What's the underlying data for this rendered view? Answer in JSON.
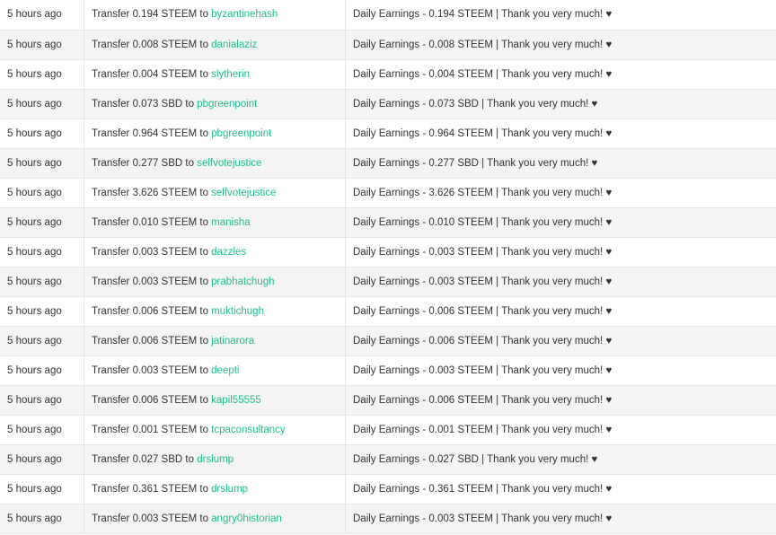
{
  "history": {
    "rows": [
      {
        "time": "5 hours ago",
        "op_prefix": "Transfer 0.194 STEEM to ",
        "account": "byzantinehash",
        "memo": "Daily Earnings - 0.194 STEEM | Thank you very much! ",
        "heart": "♥"
      },
      {
        "time": "5 hours ago",
        "op_prefix": "Transfer 0.008 STEEM to ",
        "account": "danialaziz",
        "memo": "Daily Earnings - 0.008 STEEM | Thank you very much! ",
        "heart": "♥"
      },
      {
        "time": "5 hours ago",
        "op_prefix": "Transfer 0.004 STEEM to ",
        "account": "slytherin",
        "memo": "Daily Earnings - 0.004 STEEM | Thank you very much! ",
        "heart": "♥"
      },
      {
        "time": "5 hours ago",
        "op_prefix": "Transfer 0.073 SBD to ",
        "account": "pbgreenpoint",
        "memo": "Daily Earnings - 0.073 SBD | Thank you very much! ",
        "heart": "♥"
      },
      {
        "time": "5 hours ago",
        "op_prefix": "Transfer 0.964 STEEM to ",
        "account": "pbgreenpoint",
        "memo": "Daily Earnings - 0.964 STEEM | Thank you very much! ",
        "heart": "♥"
      },
      {
        "time": "5 hours ago",
        "op_prefix": "Transfer 0.277 SBD to ",
        "account": "selfvotejustice",
        "memo": "Daily Earnings - 0.277 SBD | Thank you very much! ",
        "heart": "♥"
      },
      {
        "time": "5 hours ago",
        "op_prefix": "Transfer 3.626 STEEM to ",
        "account": "selfvotejustice",
        "memo": "Daily Earnings - 3.626 STEEM | Thank you very much! ",
        "heart": "♥"
      },
      {
        "time": "5 hours ago",
        "op_prefix": "Transfer 0.010 STEEM to ",
        "account": "manisha",
        "memo": "Daily Earnings - 0.010 STEEM | Thank you very much! ",
        "heart": "♥"
      },
      {
        "time": "5 hours ago",
        "op_prefix": "Transfer 0.003 STEEM to ",
        "account": "dazzles",
        "memo": "Daily Earnings - 0.003 STEEM | Thank you very much! ",
        "heart": "♥"
      },
      {
        "time": "5 hours ago",
        "op_prefix": "Transfer 0.003 STEEM to ",
        "account": "prabhatchugh",
        "memo": "Daily Earnings - 0.003 STEEM | Thank you very much! ",
        "heart": "♥"
      },
      {
        "time": "5 hours ago",
        "op_prefix": "Transfer 0.006 STEEM to ",
        "account": "muktichugh",
        "memo": "Daily Earnings - 0.006 STEEM | Thank you very much! ",
        "heart": "♥"
      },
      {
        "time": "5 hours ago",
        "op_prefix": "Transfer 0.006 STEEM to ",
        "account": "jatinarora",
        "memo": "Daily Earnings - 0.006 STEEM | Thank you very much! ",
        "heart": "♥"
      },
      {
        "time": "5 hours ago",
        "op_prefix": "Transfer 0.003 STEEM to ",
        "account": "deepti",
        "memo": "Daily Earnings - 0.003 STEEM | Thank you very much! ",
        "heart": "♥"
      },
      {
        "time": "5 hours ago",
        "op_prefix": "Transfer 0.006 STEEM to ",
        "account": "kapil55555",
        "memo": "Daily Earnings - 0.006 STEEM | Thank you very much! ",
        "heart": "♥"
      },
      {
        "time": "5 hours ago",
        "op_prefix": "Transfer 0.001 STEEM to ",
        "account": "tcpaconsultancy",
        "memo": "Daily Earnings - 0.001 STEEM | Thank you very much! ",
        "heart": "♥"
      },
      {
        "time": "5 hours ago",
        "op_prefix": "Transfer 0.027 SBD to ",
        "account": "drslump",
        "memo": "Daily Earnings - 0.027 SBD | Thank you very much! ",
        "heart": "♥"
      },
      {
        "time": "5 hours ago",
        "op_prefix": "Transfer 0.361 STEEM to ",
        "account": "drslump",
        "memo": "Daily Earnings - 0.361 STEEM | Thank you very much! ",
        "heart": "♥"
      },
      {
        "time": "5 hours ago",
        "op_prefix": "Transfer 0.003 STEEM to ",
        "account": "angry0historian",
        "memo": "Daily Earnings - 0.003 STEEM | Thank you very much! ",
        "heart": "♥"
      }
    ]
  },
  "colors": {
    "link": "#1fbf8f",
    "row_alt": "#f4f4f4",
    "border": "#e6e6e6"
  }
}
